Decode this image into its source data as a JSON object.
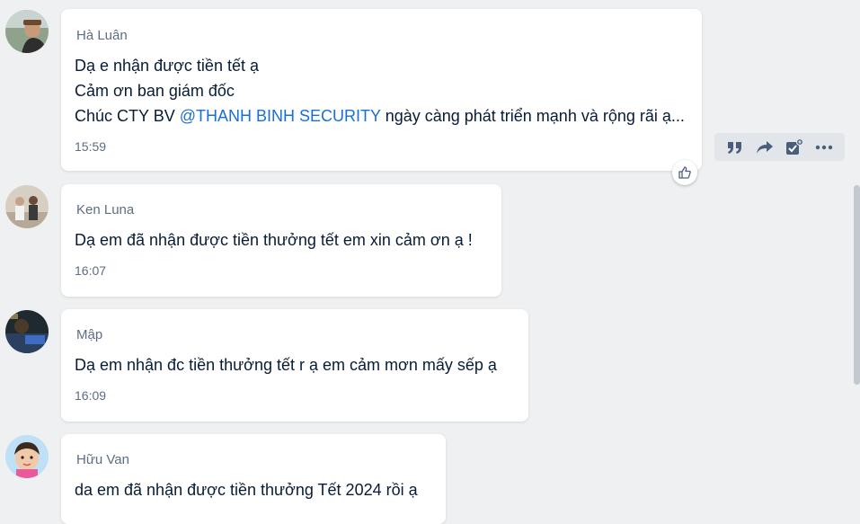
{
  "messages": [
    {
      "sender": "Hà Luân",
      "lines": [
        "Dạ e nhận được tiền tết ạ",
        "Cảm ơn ban giám đốc"
      ],
      "line3_prefix": "Chúc CTY BV ",
      "mention": "@THANH BINH SECURITY",
      "line3_suffix": " ngày càng phát triển mạnh và rộng rãi ạ...",
      "time": "15:59"
    },
    {
      "sender": "Ken Luna",
      "text": "Dạ em đã nhận được tiền thưởng tết em xin cảm ơn ạ !",
      "time": "16:07"
    },
    {
      "sender": "Mập",
      "text": "Dạ em nhận đc tiền thưởng tết r ạ em cảm mơn mấy sếp ạ",
      "time": "16:09"
    },
    {
      "sender": "Hữu Van",
      "text": "da em đã nhận được tiền thưởng Tết 2024 rồi ạ"
    }
  ],
  "icons": {
    "quote": "quote-icon",
    "forward": "forward-icon",
    "todo": "task-icon",
    "more": "more-icon",
    "like": "thumbs-up-icon"
  },
  "colors": {
    "mention": "#1a6ed8",
    "icon": "#4a5e7c",
    "background": "#eef0f1"
  }
}
